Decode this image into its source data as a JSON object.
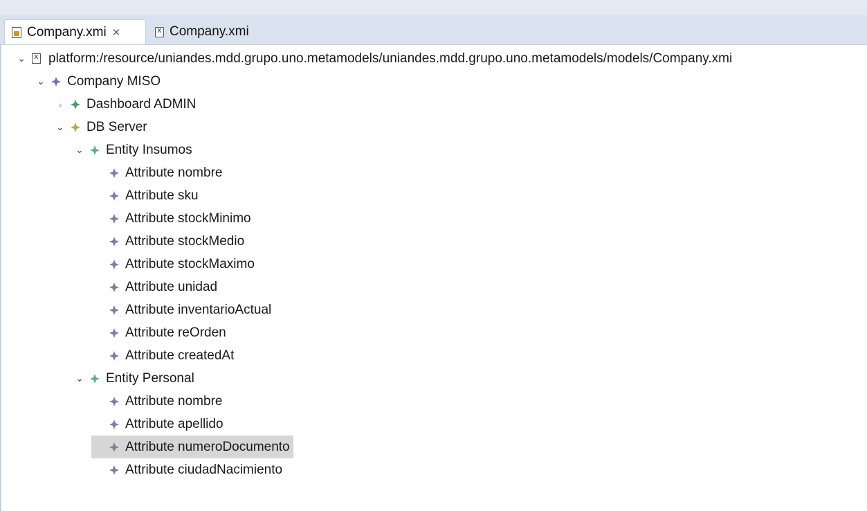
{
  "tabs": [
    {
      "label": "Company.xmi",
      "close_glyph": "✕",
      "icon": "model-editor-icon",
      "active": true
    },
    {
      "label": "Company.xmi",
      "icon": "xml-file-icon",
      "active": false
    }
  ],
  "tree": {
    "root": {
      "label": "platform:/resource/uniandes.mdd.grupo.uno.metamodels/uniandes.mdd.grupo.uno.metamodels/models/Company.xmi"
    },
    "company": {
      "label": "Company MISO"
    },
    "dashboard": {
      "label": "Dashboard ADMIN"
    },
    "dbserver": {
      "label": "DB Server"
    },
    "entity_insumos": {
      "label": "Entity Insumos",
      "attributes": [
        "Attribute nombre",
        "Attribute sku",
        "Attribute stockMinimo",
        "Attribute stockMedio",
        "Attribute stockMaximo",
        "Attribute unidad",
        "Attribute inventarioActual",
        "Attribute reOrden",
        "Attribute createdAt"
      ]
    },
    "entity_personal": {
      "label": "Entity Personal",
      "attributes": [
        "Attribute nombre",
        "Attribute apellido",
        "Attribute numeroDocumento",
        "Attribute ciudadNacimiento"
      ]
    }
  },
  "colors": {
    "company_icon": "#7a6fb0",
    "dashboard_icon": "#4a9a6a",
    "dbserver_icon": "#b8a84a",
    "entity_icon": "#5fb08a",
    "attribute_icon": "#8a7a9a",
    "selection": "#d6d6d6"
  }
}
